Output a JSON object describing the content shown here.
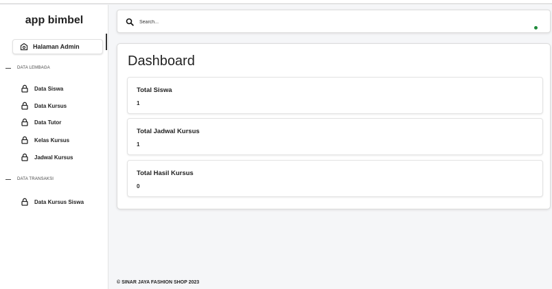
{
  "sidebar": {
    "brand": "app bimbel",
    "active_item": {
      "label": "Halaman Admin",
      "icon": "gauge-icon"
    },
    "sections": [
      {
        "title": "DATA LEMBAGA",
        "items": [
          {
            "label": "Data Siswa",
            "icon": "lock-icon"
          },
          {
            "label": "Data Kursus",
            "icon": "lock-icon"
          },
          {
            "label": "Data Tutor",
            "icon": "lock-icon"
          },
          {
            "label": "Kelas Kursus",
            "icon": "lock-icon"
          },
          {
            "label": "Jadwal Kursus",
            "icon": "lock-icon"
          }
        ]
      },
      {
        "title": "DATA TRANSAKSI",
        "items": [
          {
            "label": "Data Kursus Siswa",
            "icon": "lock-icon"
          }
        ]
      }
    ]
  },
  "search": {
    "placeholder": "Search...",
    "icon": "search-icon"
  },
  "status": {
    "color": "#1e8a3a"
  },
  "dashboard": {
    "title": "Dashboard",
    "stats": [
      {
        "label": "Total Siswa",
        "value": "1"
      },
      {
        "label": "Total Jadwal Kursus",
        "value": "1"
      },
      {
        "label": "Total Hasil Kursus",
        "value": "0"
      }
    ]
  },
  "footer": {
    "text": "© SINAR JAYA FASHION SHOP 2023"
  }
}
